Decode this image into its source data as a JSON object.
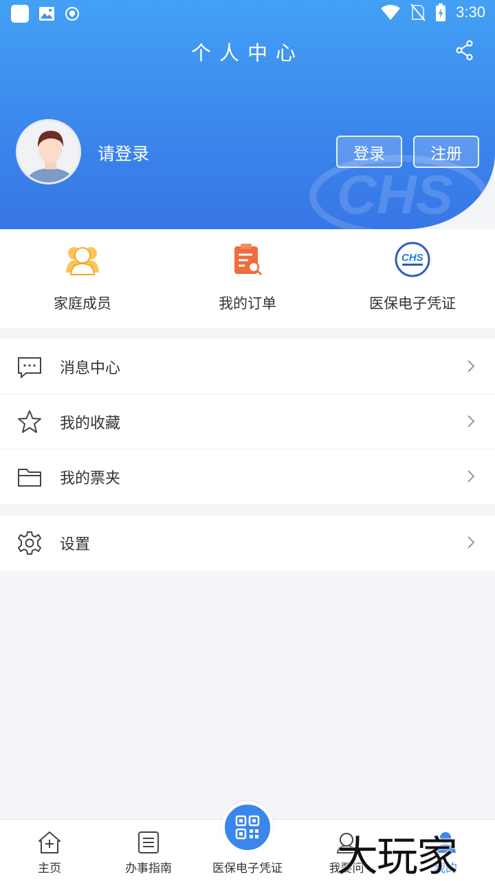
{
  "status_bar": {
    "time": "3:30"
  },
  "header": {
    "title": "个人中心",
    "login_prompt": "请登录",
    "login_button": "登录",
    "register_button": "注册",
    "watermark_logo": "CHS"
  },
  "quick_actions": [
    {
      "label": "家庭成员",
      "icon": "family-members-icon"
    },
    {
      "label": "我的订单",
      "icon": "order-icon"
    },
    {
      "label": "医保电子凭证",
      "icon": "chs-logo-icon"
    }
  ],
  "menu": {
    "group1": [
      {
        "label": "消息中心",
        "icon": "message-icon"
      },
      {
        "label": "我的收藏",
        "icon": "star-icon"
      },
      {
        "label": "我的票夹",
        "icon": "folder-icon"
      }
    ],
    "group2": [
      {
        "label": "设置",
        "icon": "gear-icon"
      }
    ]
  },
  "bottom_nav": {
    "items": [
      {
        "label": "主页",
        "icon": "home-icon"
      },
      {
        "label": "办事指南",
        "icon": "guide-icon"
      },
      {
        "label": "医保电子凭证",
        "icon": "qr-code-icon"
      },
      {
        "label": "我要问",
        "icon": "service-icon"
      },
      {
        "label": "我的",
        "icon": "profile-icon"
      }
    ],
    "active_color": "#3a86ea"
  },
  "watermark_text": "大玩家",
  "colors": {
    "primary": "#3b85ec",
    "accent_orange": "#f5a623",
    "accent_red": "#f26b3a"
  }
}
